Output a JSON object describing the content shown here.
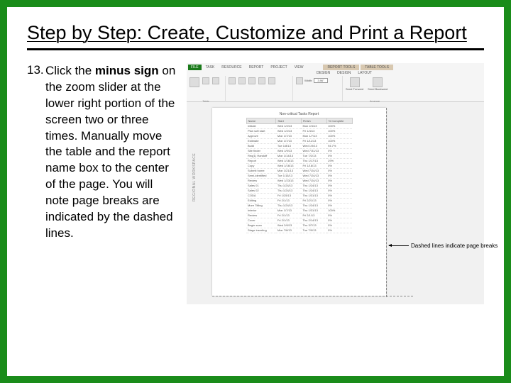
{
  "title": "Step by Step: Create, Customize and Print a Report",
  "step": {
    "number": "13.",
    "part1": "Click the ",
    "bold": "minus sign",
    "part2": " on the zoom slider at the lower right portion of the screen two or three times. Manually move the table and the report name box to the center of the page. You will note page breaks are indicated by the dashed lines."
  },
  "ribbon": {
    "tabs": [
      "FILE",
      "TASK",
      "RESOURCE",
      "REPORT",
      "PROJECT",
      "VIEW"
    ],
    "groups": [
      "REPORT TOOLS",
      "TABLE TOOLS"
    ],
    "group_tabs": [
      "DESIGN",
      "DESIGN",
      "LAYOUT"
    ],
    "sections": {
      "table": "Table",
      "width_label": "Width:",
      "width_value": "3.96\"",
      "send_forward": "Send Forward",
      "send_backward": "Send Backward",
      "arrange": "Arrange"
    }
  },
  "report": {
    "vtext": "REGIONAL WORKSPACE",
    "title": "Non-critical Tasks Report",
    "headers": [
      "Name",
      "Start",
      "Finish",
      "% Complete"
    ],
    "rows": [
      [
        "Initiate",
        "Wed 1/2/13",
        "Mon 2/4/13",
        "100%"
      ],
      [
        "Plan soft start",
        "Wed 1/2/13",
        "Fri 1/4/13",
        "100%"
      ],
      [
        "Approve",
        "Mon 1/7/13",
        "Mon 1/7/13",
        "100%"
      ],
      [
        "Estimate",
        "Mon 1/7/13",
        "Fri 1/11/13",
        "100%"
      ],
      [
        "Build",
        "Tue 1/8/13",
        "Wed 1/9/13",
        "94.7%"
      ],
      [
        "Site finder",
        "Wed 1/9/13",
        "Wed 7/31/13",
        "0%"
      ],
      [
        "Req(1) Handoff",
        "Mon 1/14/13",
        "Tue 7/2/13",
        "0%"
      ],
      [
        "Report",
        "Wed 1/16/13",
        "Thu 1/17/13",
        "29%"
      ],
      [
        "Copy",
        "Wed 1/16/13",
        "Fri 1/18/13",
        "0%"
      ],
      [
        "Submit home",
        "Mon 1/21/13",
        "Wed 7/24/13",
        "0%"
      ],
      [
        "Semi-identified",
        "Tue 1/15/13",
        "Wed 7/24/13",
        "0%"
      ],
      [
        "Review",
        "Wed 1/23/13",
        "Wed 7/24/13",
        "0%"
      ],
      [
        "Sales 01",
        "Thu 1/24/13",
        "Thu 1/24/13",
        "0%"
      ],
      [
        "Sales 02",
        "Thu 1/24/13",
        "Thu 1/24/13",
        "0%"
      ],
      [
        "CODA",
        "Fri 1/25/13",
        "Thu 1/31/13",
        "0%"
      ],
      [
        "Editing",
        "Fri 2/1/13",
        "Fri 2/21/13",
        "0%"
      ],
      [
        "More Titling",
        "Thu 1/24/13",
        "Thu 1/24/13",
        "0%"
      ],
      [
        "Interior",
        "Mon 1/7/13",
        "Thu 1/31/13",
        "100%"
      ],
      [
        "Review",
        "Fri 2/1/13",
        "Fri 2/1/13",
        "0%"
      ],
      [
        "Cover",
        "Fri 2/1/13",
        "Thu 2/14/13",
        "0%"
      ],
      [
        "Begin scan",
        "Wed 2/6/13",
        "Thu 3/7/13",
        "0%"
      ],
      [
        "Stage inserting",
        "Mon 7/8/13",
        "Tue 7/9/13",
        "0%"
      ]
    ]
  },
  "callout": "Dashed lines indicate page breaks"
}
